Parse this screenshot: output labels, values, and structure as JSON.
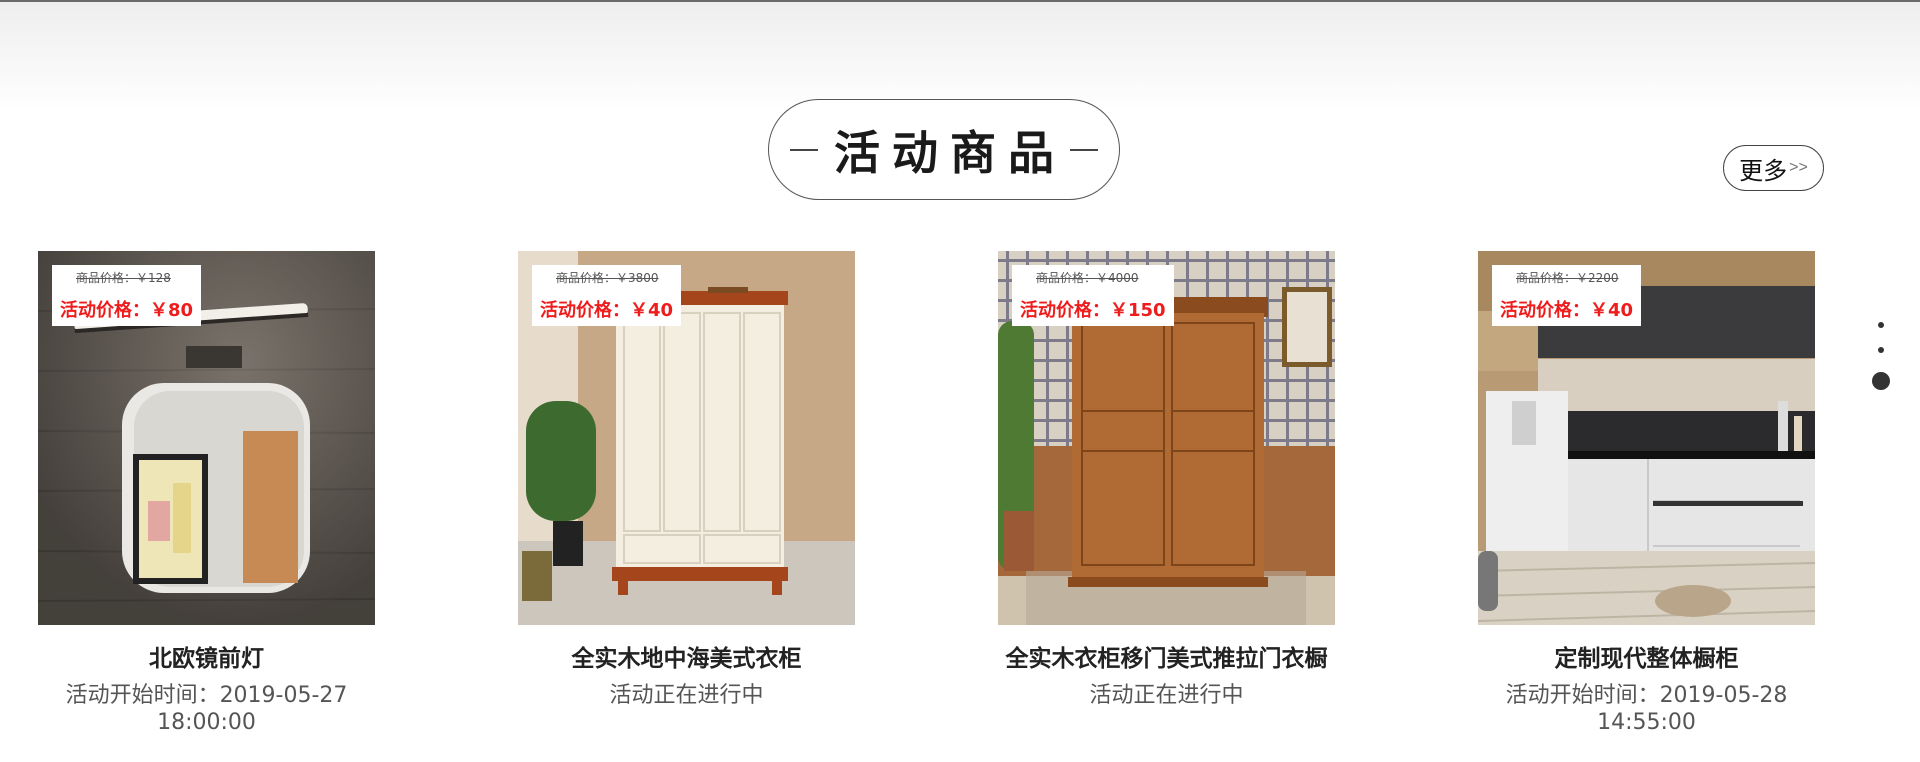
{
  "section": {
    "title": "活动商品",
    "more_label": "更多",
    "more_arrow": ">>"
  },
  "products": [
    {
      "name": "北欧镜前灯",
      "original_price": "商品价格：￥128",
      "activity_price": "活动价格：￥80",
      "status_line1": "活动开始时间：2019-05-27",
      "status_line2": "18:00:00"
    },
    {
      "name": "全实木地中海美式衣柜",
      "original_price": "商品价格：￥3800",
      "activity_price": "活动价格：￥40",
      "status_line1": "活动正在进行中",
      "status_line2": ""
    },
    {
      "name": "全实木衣柜移门美式推拉门衣橱",
      "original_price": "商品价格：￥4000",
      "activity_price": "活动价格：￥150",
      "status_line1": "活动正在进行中",
      "status_line2": ""
    },
    {
      "name": "定制现代整体橱柜",
      "original_price": "商品价格：￥2200",
      "activity_price": "活动价格：￥40",
      "status_line1": "活动开始时间：2019-05-28",
      "status_line2": "14:55:00"
    }
  ],
  "pager": {
    "count": 3,
    "active_index": 2
  },
  "colors": {
    "activity_price": "#ee1c1c",
    "border": "#555555"
  }
}
